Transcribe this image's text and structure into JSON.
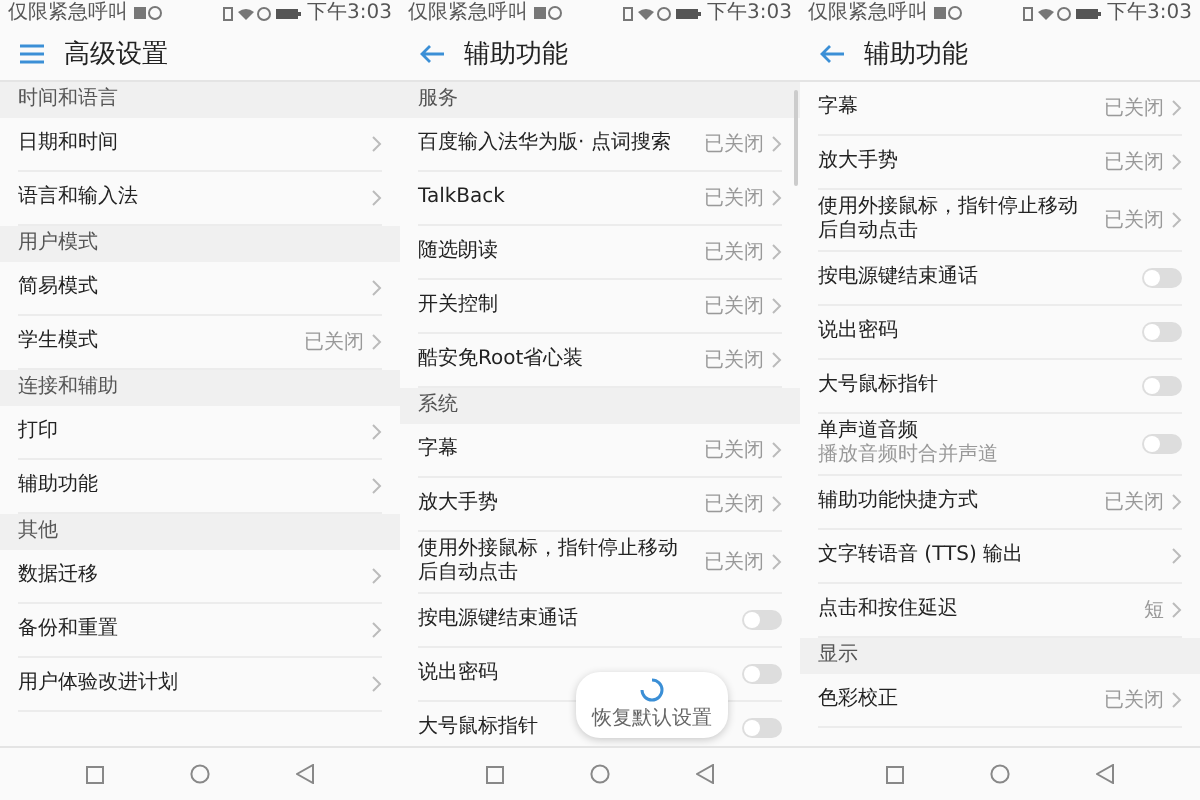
{
  "screens": [
    {
      "status_bar": {
        "carrier": "仅限紧急呼叫",
        "time": "下午3:03"
      },
      "header": {
        "kind": "menu",
        "title": "高级设置"
      },
      "scrollbar": false,
      "entries": [
        {
          "kind": "section",
          "label": "时间和语言"
        },
        {
          "kind": "link",
          "label": "日期和时间"
        },
        {
          "kind": "link",
          "label": "语言和输入法"
        },
        {
          "kind": "section",
          "label": "用户模式"
        },
        {
          "kind": "link",
          "label": "简易模式"
        },
        {
          "kind": "link",
          "label": "学生模式",
          "value": "已关闭"
        },
        {
          "kind": "section",
          "label": "连接和辅助"
        },
        {
          "kind": "link",
          "label": "打印"
        },
        {
          "kind": "link",
          "label": "辅助功能"
        },
        {
          "kind": "section",
          "label": "其他"
        },
        {
          "kind": "link",
          "label": "数据迁移"
        },
        {
          "kind": "link",
          "label": "备份和重置"
        },
        {
          "kind": "link",
          "label": "用户体验改进计划"
        }
      ]
    },
    {
      "status_bar": {
        "carrier": "仅限紧急呼叫",
        "time": "下午3:03"
      },
      "header": {
        "kind": "back",
        "title": "辅助功能"
      },
      "scrollbar": true,
      "toast": {
        "label": "恢复默认设置"
      },
      "entries": [
        {
          "kind": "section",
          "label": "服务"
        },
        {
          "kind": "link",
          "label": "百度输入法华为版· 点词搜索",
          "value": "已关闭"
        },
        {
          "kind": "link",
          "label": "TalkBack",
          "value": "已关闭"
        },
        {
          "kind": "link",
          "label": "随选朗读",
          "value": "已关闭"
        },
        {
          "kind": "link",
          "label": "开关控制",
          "value": "已关闭"
        },
        {
          "kind": "link",
          "label": "酷安免Root省心装",
          "value": "已关闭"
        },
        {
          "kind": "section",
          "label": "系统"
        },
        {
          "kind": "link",
          "label": "字幕",
          "value": "已关闭"
        },
        {
          "kind": "link",
          "label": "放大手势",
          "value": "已关闭"
        },
        {
          "kind": "link",
          "label": "使用外接鼠标，指针停止移动后自动点击",
          "value": "已关闭"
        },
        {
          "kind": "toggle",
          "label": "按电源键结束通话",
          "on": false
        },
        {
          "kind": "toggle",
          "label": "说出密码",
          "on": false
        },
        {
          "kind": "toggle",
          "label": "大号鼠标指针",
          "on": false
        }
      ]
    },
    {
      "status_bar": {
        "carrier": "仅限紧急呼叫",
        "time": "下午3:03"
      },
      "header": {
        "kind": "back",
        "title": "辅助功能"
      },
      "scrollbar": false,
      "entries": [
        {
          "kind": "link",
          "label": "字幕",
          "value": "已关闭"
        },
        {
          "kind": "link",
          "label": "放大手势",
          "value": "已关闭"
        },
        {
          "kind": "link",
          "label": "使用外接鼠标，指针停止移动后自动点击",
          "value": "已关闭"
        },
        {
          "kind": "toggle",
          "label": "按电源键结束通话",
          "on": false
        },
        {
          "kind": "toggle",
          "label": "说出密码",
          "on": false
        },
        {
          "kind": "toggle",
          "label": "大号鼠标指针",
          "on": false
        },
        {
          "kind": "toggle",
          "label": "单声道音频",
          "sublabel": "播放音频时合并声道",
          "on": false
        },
        {
          "kind": "link",
          "label": "辅助功能快捷方式",
          "value": "已关闭"
        },
        {
          "kind": "link",
          "label": "文字转语音 (TTS) 输出"
        },
        {
          "kind": "link",
          "label": "点击和按住延迟",
          "value": "短"
        },
        {
          "kind": "section",
          "label": "显示"
        },
        {
          "kind": "link",
          "label": "色彩校正",
          "value": "已关闭"
        }
      ]
    }
  ]
}
